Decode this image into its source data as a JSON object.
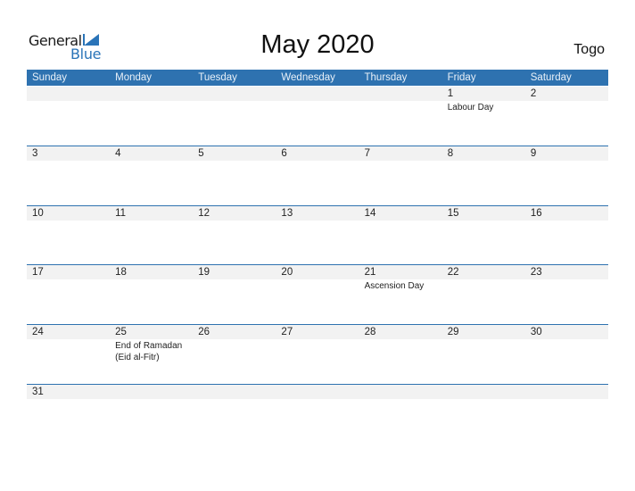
{
  "logo": {
    "general": "General",
    "blue": "Blue",
    "accent_color": "#2a74b8"
  },
  "title": "May 2020",
  "country": "Togo",
  "weekdays": [
    "Sunday",
    "Monday",
    "Tuesday",
    "Wednesday",
    "Thursday",
    "Friday",
    "Saturday"
  ],
  "header_color": "#2e72b0",
  "weeks": [
    [
      {
        "day": ""
      },
      {
        "day": ""
      },
      {
        "day": ""
      },
      {
        "day": ""
      },
      {
        "day": ""
      },
      {
        "day": "1",
        "event": "Labour Day"
      },
      {
        "day": "2"
      }
    ],
    [
      {
        "day": "3"
      },
      {
        "day": "4"
      },
      {
        "day": "5"
      },
      {
        "day": "6"
      },
      {
        "day": "7"
      },
      {
        "day": "8"
      },
      {
        "day": "9"
      }
    ],
    [
      {
        "day": "10"
      },
      {
        "day": "11"
      },
      {
        "day": "12"
      },
      {
        "day": "13"
      },
      {
        "day": "14"
      },
      {
        "day": "15"
      },
      {
        "day": "16"
      }
    ],
    [
      {
        "day": "17"
      },
      {
        "day": "18"
      },
      {
        "day": "19"
      },
      {
        "day": "20"
      },
      {
        "day": "21",
        "event": "Ascension Day"
      },
      {
        "day": "22"
      },
      {
        "day": "23"
      }
    ],
    [
      {
        "day": "24"
      },
      {
        "day": "25",
        "event": "End of Ramadan (Eid al-Fitr)"
      },
      {
        "day": "26"
      },
      {
        "day": "27"
      },
      {
        "day": "28"
      },
      {
        "day": "29"
      },
      {
        "day": "30"
      }
    ],
    [
      {
        "day": "31"
      },
      {
        "day": ""
      },
      {
        "day": ""
      },
      {
        "day": ""
      },
      {
        "day": ""
      },
      {
        "day": ""
      },
      {
        "day": ""
      }
    ]
  ]
}
